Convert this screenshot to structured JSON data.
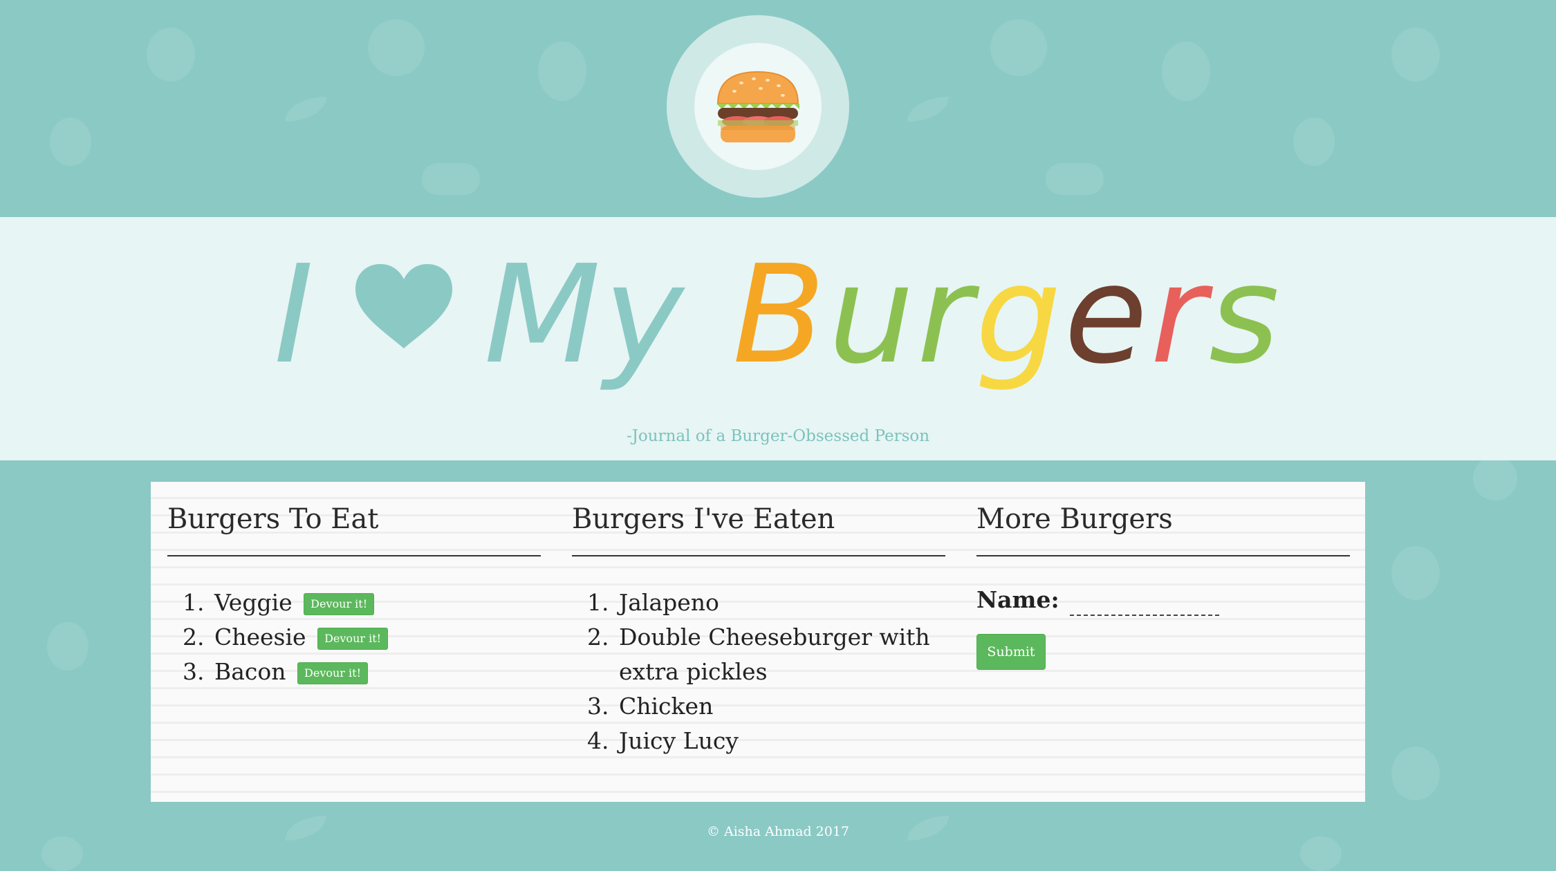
{
  "header": {
    "logo_icon": "burger-icon",
    "title": {
      "part_i": "I",
      "heart_icon": "heart-icon",
      "part_my": "My",
      "burgers_letters": [
        {
          "char": "B",
          "color": "#f5a623"
        },
        {
          "char": "u",
          "color": "#8cc152"
        },
        {
          "char": "r",
          "color": "#8cc152"
        },
        {
          "char": "g",
          "color": "#f7d842"
        },
        {
          "char": "e",
          "color": "#6d3f2e"
        },
        {
          "char": "r",
          "color": "#e8605b"
        },
        {
          "char": "s",
          "color": "#8cc152"
        }
      ]
    },
    "subtitle": "-Journal of a Burger-Obsessed Person"
  },
  "colors": {
    "background": "#8bc9c5",
    "band": "#e7f5f4",
    "accent_teal": "#8bc9c5",
    "button_green": "#5cb85c"
  },
  "columns": {
    "to_eat": {
      "heading": "Burgers To Eat",
      "button_label": "Devour it!",
      "items": [
        "Veggie",
        "Cheesie",
        "Bacon"
      ]
    },
    "eaten": {
      "heading": "Burgers I've Eaten",
      "items": [
        "Jalapeno",
        "Double Cheeseburger with extra pickles",
        "Chicken",
        "Juicy Lucy"
      ]
    },
    "more": {
      "heading": "More Burgers",
      "name_label": "Name:",
      "name_value": "",
      "submit_label": "Submit"
    }
  },
  "footer": {
    "text": "© Aisha Ahmad 2017"
  }
}
